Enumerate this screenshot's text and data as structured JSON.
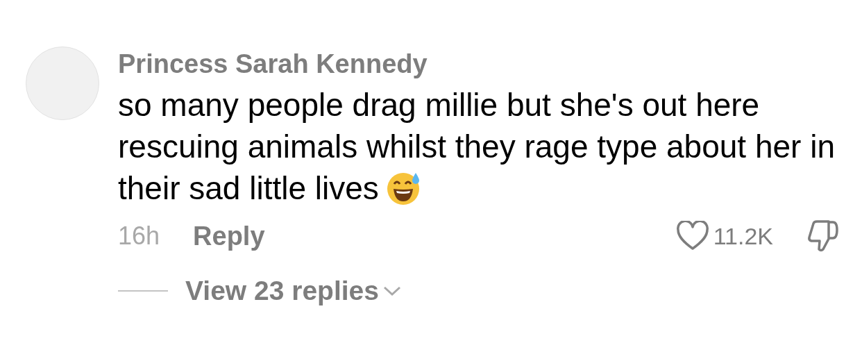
{
  "comment": {
    "author": "Princess Sarah Kennedy",
    "text": "so many people drag millie but she's out here rescuing animals whilst they rage type about her in their sad little lives",
    "time": "16h",
    "reply_label": "Reply",
    "likes": "11.2K",
    "liked": false,
    "disliked": false,
    "view_replies": "View 23 replies"
  }
}
